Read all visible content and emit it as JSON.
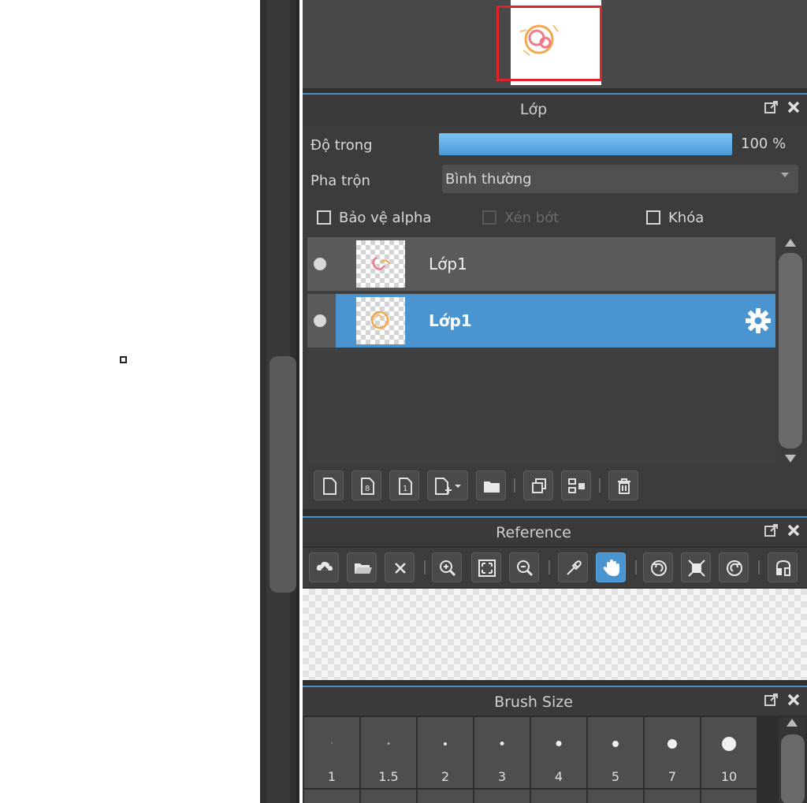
{
  "layer_panel": {
    "title": "Lớp",
    "opacity_label": "Độ trong",
    "opacity_value": "100 %",
    "opacity_fraction": 1.0,
    "blend_label": "Pha trộn",
    "blend_value": "Bình thường",
    "protect_alpha_label": "Bảo vệ alpha",
    "clipping_label": "Xén bớt",
    "lock_label": "Khóa",
    "layers": [
      {
        "name": "Lớp1",
        "selected": false
      },
      {
        "name": "Lớp1",
        "selected": true
      }
    ]
  },
  "reference_panel": {
    "title": "Reference"
  },
  "brush_panel": {
    "title": "Brush Size",
    "sizes": [
      "1",
      "1.5",
      "2",
      "3",
      "4",
      "5",
      "7",
      "10"
    ]
  },
  "icons": {
    "float": "popout-icon",
    "close": "close-icon",
    "gear": "gear-icon"
  },
  "colors": {
    "accent": "#4a95d0",
    "navigator_frame": "#e0222a",
    "panel_bg": "#3c3c3c"
  }
}
